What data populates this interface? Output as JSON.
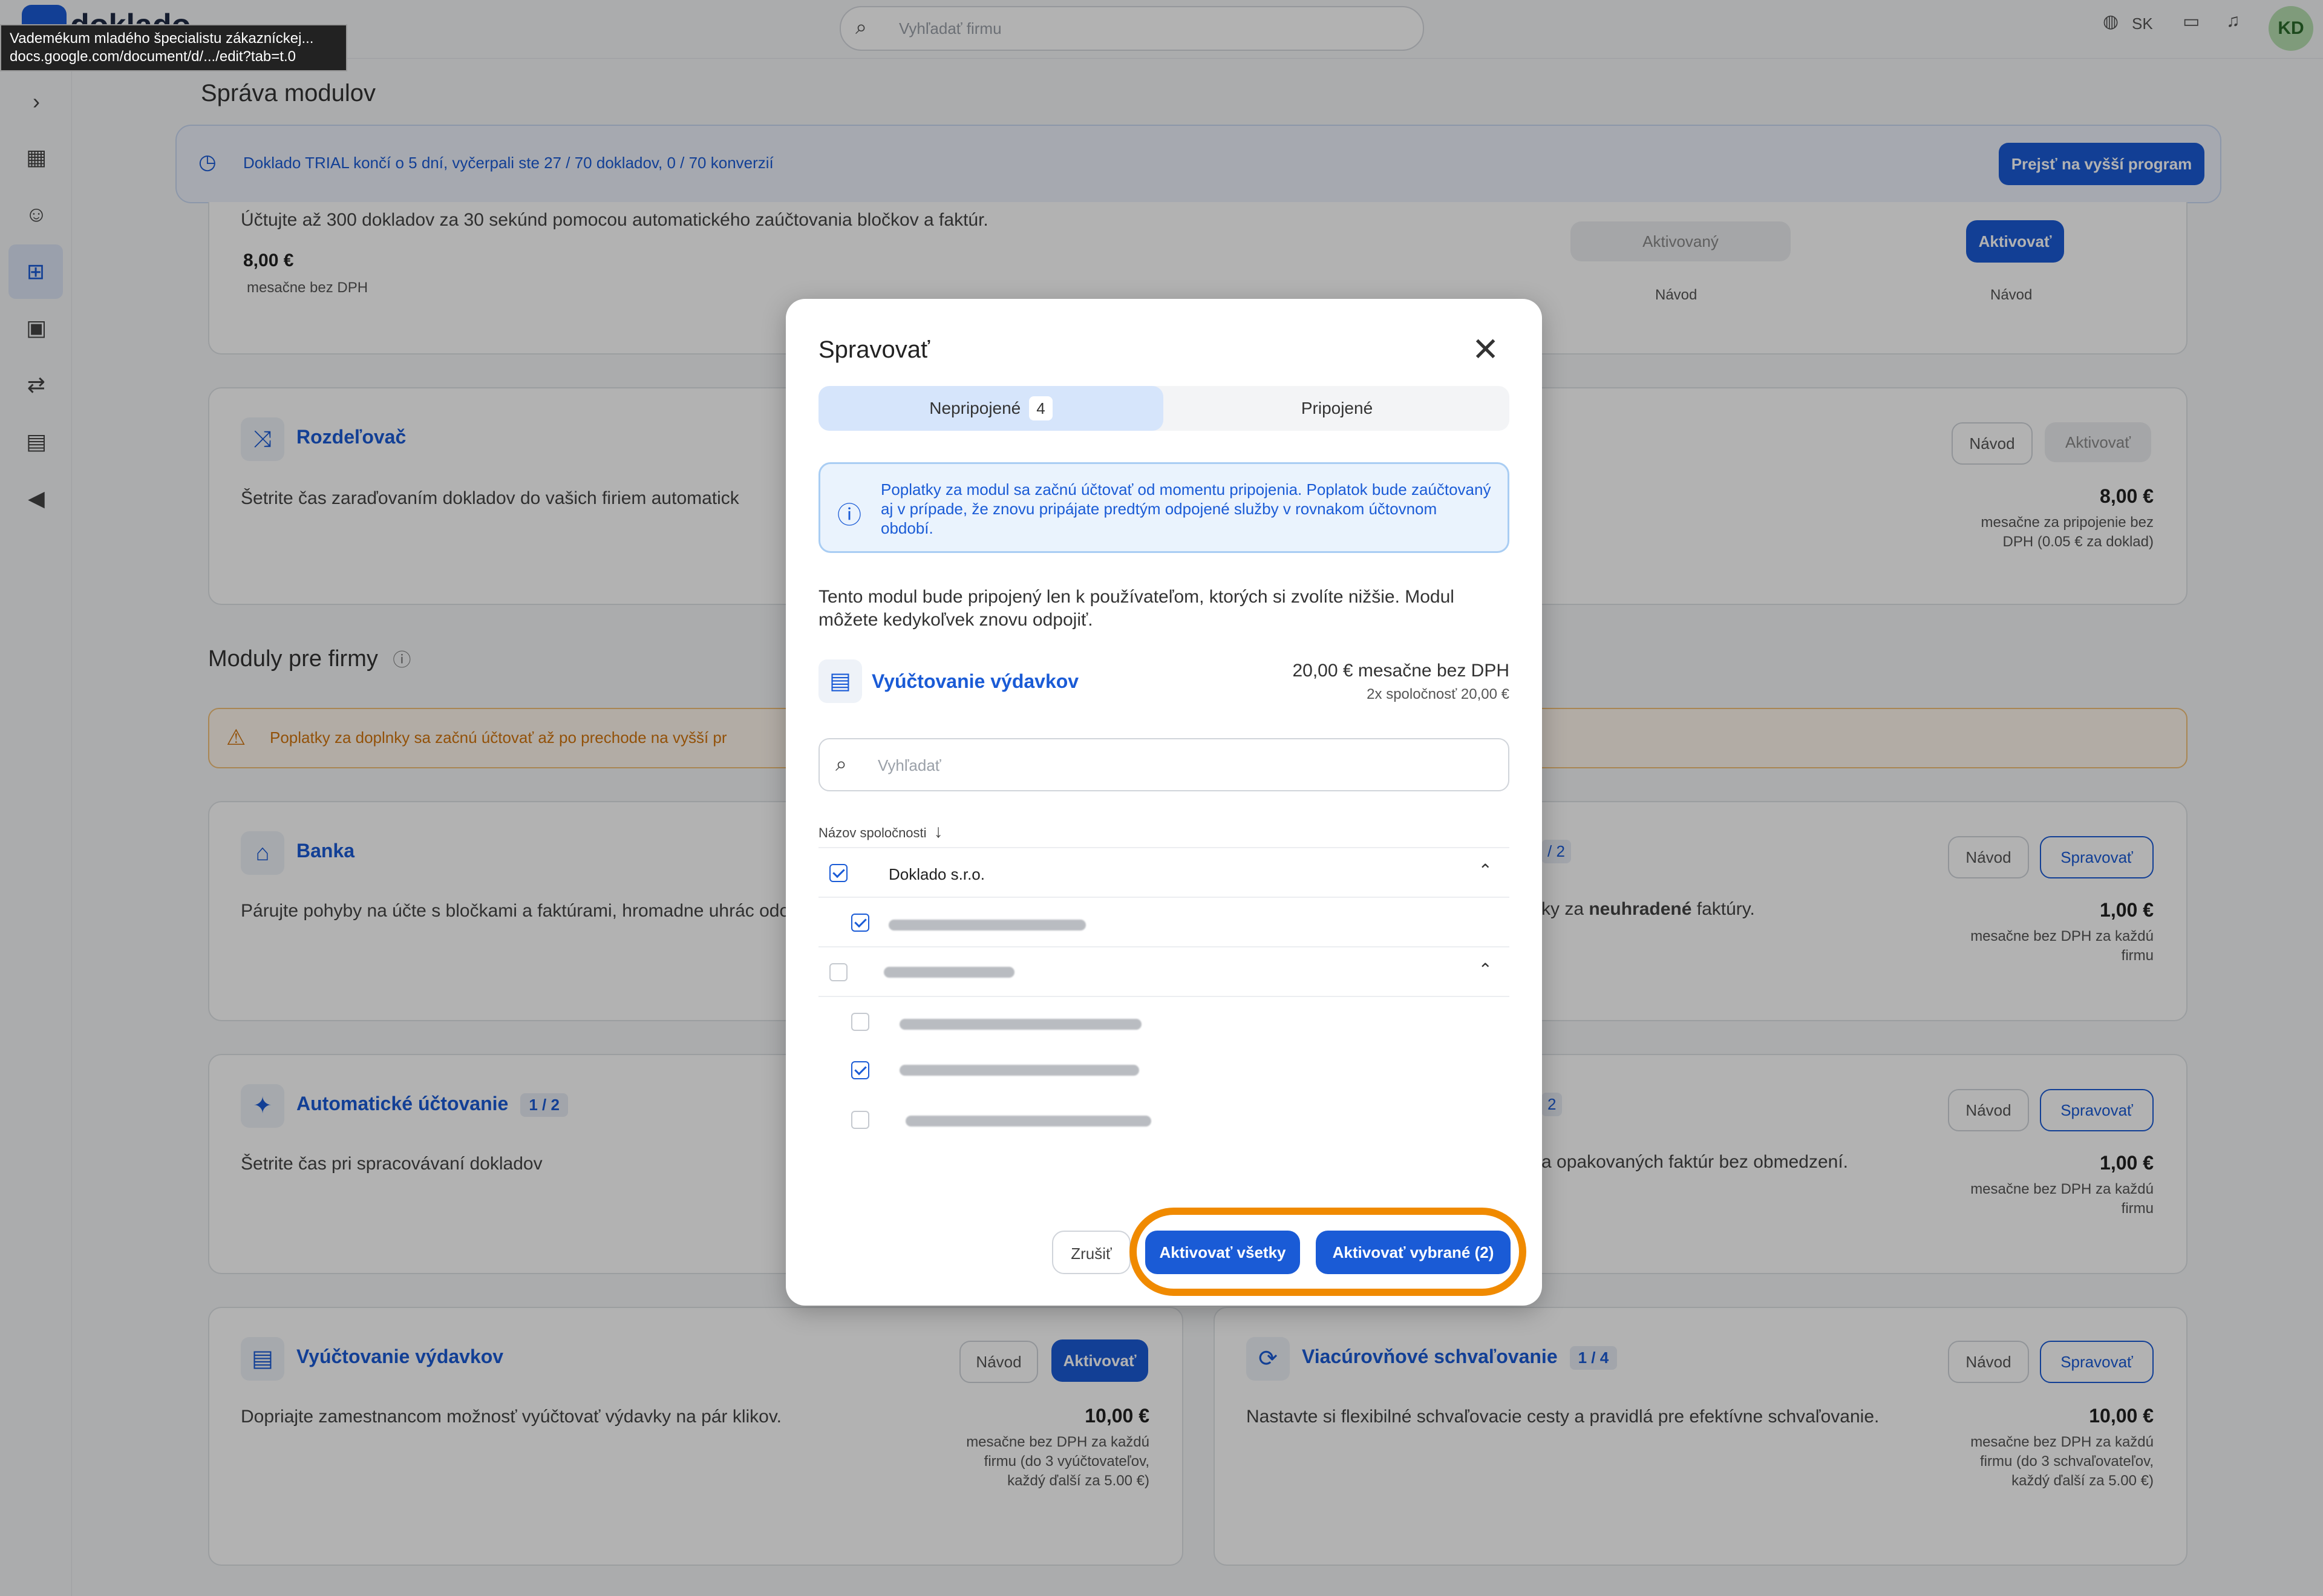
{
  "tooltip": {
    "line1": "Vademékum mladého špecialistu zákazníckej...",
    "line2": "docs.google.com/document/d/.../edit?tab=t.0"
  },
  "header": {
    "app_name": "doklado",
    "search_placeholder": "Vyhľadať firmu",
    "language": "SK",
    "user_initials": "KD"
  },
  "page": {
    "title": "Správa modulov",
    "trial_text": "Doklado TRIAL končí o 5 dní, vyčerpali ste 27 / 70 dokladov, 0 / 70 konverzií",
    "upgrade_button": "Prejsť na vyšší program",
    "section_title": "Moduly pre firmy",
    "warning_text": "Poplatky za doplnky sa začnú účtovať až po prechode na vyšší pr"
  },
  "cards": {
    "top": {
      "desc": "Účtujte až 300 dokladov za 30 sekúnd pomocou automatického zaúčtovania bločkov a faktúr.",
      "price": "8,00 €",
      "price_sub": "mesačne bez DPH",
      "activated": "Aktivovaný",
      "activate": "Aktivovať",
      "guide1": "Návod",
      "guide2": "Návod"
    },
    "splitter": {
      "name": "Rozdeľovač",
      "desc": "Šetrite čas zaraďovaním dokladov do vašich firiem automatick",
      "guide": "Návod",
      "activate": "Aktivovať",
      "price": "8,00 €",
      "price_sub": "mesačne za pripojenie bez DPH (0.05 € za doklad)"
    },
    "bank": {
      "name": "Banka",
      "desc": "Párujte pohyby na účte s bločkami a faktúrami, hromadne uhrác odovzdávajte výpisy."
    },
    "right_bank": {
      "badge": "/ 2",
      "desc_a": "ky za ",
      "desc_b": "neuhradené",
      "desc_c": " faktúry.",
      "guide": "Návod",
      "manage": "Spravovať",
      "price": "1,00 €",
      "price_sub": "mesačne bez DPH za každú firmu"
    },
    "auto": {
      "name": "Automatické účtovanie",
      "badge": "1 / 2",
      "desc": "Šetrite čas pri spracovávaní dokladov"
    },
    "right_auto": {
      "badge": "2",
      "desc": "a opakovaných faktúr bez obmedzení.",
      "guide": "Návod",
      "manage": "Spravovať",
      "price": "1,00 €",
      "price_sub": "mesačne bez DPH za každú firmu"
    },
    "expenses": {
      "name": "Vyúčtovanie výdavkov",
      "desc": "Dopriajte zamestnancom možnosť vyúčtovať výdavky na pár klikov.",
      "guide": "Návod",
      "activate": "Aktivovať",
      "price": "10,00 €",
      "price_sub": "mesačne bez DPH za každú firmu (do 3 vyúčtovateľov, každý ďalší za 5.00 €)"
    },
    "approval": {
      "name": "Viacúrovňové schvaľovanie",
      "badge": "1 / 4",
      "desc": "Nastavte si flexibilné schvaľovacie cesty a pravidlá pre efektívne schvaľovanie.",
      "guide": "Návod",
      "manage": "Spravovať",
      "price": "10,00 €",
      "price_sub": "mesačne bez DPH za každú firmu (do 3 schvaľovateľov, každý ďalší za 5.00 €)"
    }
  },
  "modal": {
    "title": "Spravovať",
    "tab_unconnected": "Nepripojené",
    "tab_unconnected_count": "4",
    "tab_connected": "Pripojené",
    "info": "Poplatky za modul sa začnú účtovať od momentu pripojenia. Poplatok bude zaúčtovaný aj v prípade, že znovu pripájate predtým odpojené služby v rovnakom účtovnom období.",
    "desc": "Tento modul bude pripojený len k používateľom, ktorých si zvolíte nižšie. Modul môžete kedykoľvek znovu odpojiť.",
    "module_name": "Vyúčtovanie výdavkov",
    "module_price": "20,00 €  mesačne bez DPH",
    "module_price_sub": "2x spoločnosť 20,00 €",
    "search_placeholder": "Vyhľadať",
    "column_header": "Názov spoločnosti",
    "company1": "Doklado s.r.o.",
    "cancel": "Zrušiť",
    "activate_all": "Aktivovať všetky",
    "activate_selected": "Aktivovať vybrané (2)"
  }
}
